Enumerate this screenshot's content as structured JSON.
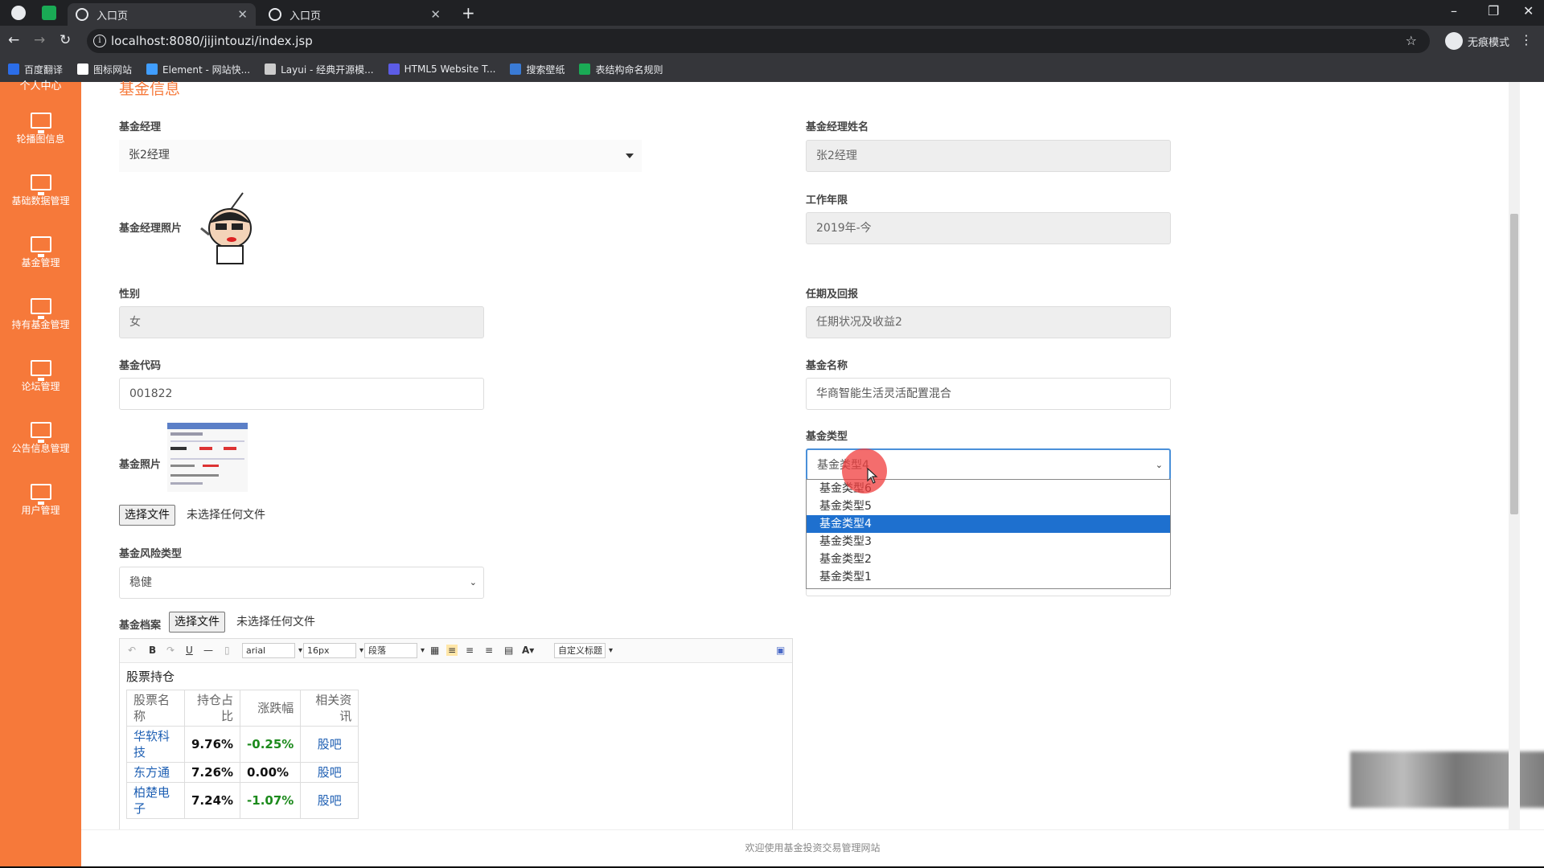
{
  "browser": {
    "tabs": [
      {
        "label": "入口页"
      },
      {
        "label": "入口页"
      }
    ],
    "url": "localhost:8080/jijintouzi/index.jsp",
    "incognito_label": "无痕模式",
    "bookmarks": [
      {
        "label": "百度翻译",
        "color": "#2b6de8"
      },
      {
        "label": "图标网站",
        "color": "#ffffff"
      },
      {
        "label": "Element - 网站快...",
        "color": "#409eff"
      },
      {
        "label": "Layui - 经典开源模...",
        "color": "#cccccc"
      },
      {
        "label": "HTML5 Website T...",
        "color": "#5c5ce6"
      },
      {
        "label": "搜索壁纸",
        "color": "#3a7bd5"
      },
      {
        "label": "表结构命名规则",
        "color": "#1aaa55"
      }
    ]
  },
  "sidebar": {
    "top_label": "个人中心",
    "items": [
      {
        "label": "轮播图信息"
      },
      {
        "label": "基础数据管理"
      },
      {
        "label": "基金管理"
      },
      {
        "label": "持有基金管理"
      },
      {
        "label": "论坛管理"
      },
      {
        "label": "公告信息管理"
      },
      {
        "label": "用户管理"
      }
    ]
  },
  "form": {
    "section_title": "基金信息",
    "manager_label": "基金经理",
    "manager_value": "张2经理",
    "manager_name_label": "基金经理姓名",
    "manager_name_value": "张2经理",
    "manager_photo_label": "基金经理照片",
    "work_years_label": "工作年限",
    "work_years_value": "2019年-今",
    "gender_label": "性别",
    "gender_value": "女",
    "tenure_label": "任期及回报",
    "tenure_value": "任期状况及收益2",
    "code_label": "基金代码",
    "code_value": "001822",
    "name_label": "基金名称",
    "name_value": "华商智能生活灵活配置混合",
    "photo_label": "基金照片",
    "type_label": "基金类型",
    "type_value": "基金类型4",
    "type_options": [
      "基金类型6",
      "基金类型5",
      "基金类型4",
      "基金类型3",
      "基金类型2",
      "基金类型1"
    ],
    "type_selected_index": 2,
    "file_button": "选择文件",
    "file_none": "未选择任何文件",
    "risk_label": "基金风险类型",
    "risk_value": "稳健",
    "archive_label": "基金档案"
  },
  "editor": {
    "font": "arial",
    "size": "16px",
    "paragraph": "段落",
    "custom_title": "自定义标题",
    "heading": "股票持仓",
    "columns": [
      "股票名称",
      "持仓占比",
      "涨跌幅",
      "相关资讯"
    ],
    "rows": [
      {
        "name": "华软科技",
        "ratio": "9.76%",
        "change": "-0.25%",
        "link": "股吧"
      },
      {
        "name": "东方通",
        "ratio": "7.26%",
        "change": "0.00%",
        "link": "股吧"
      },
      {
        "name": "柏楚电子",
        "ratio": "7.24%",
        "change": "-1.07%",
        "link": "股吧"
      }
    ]
  },
  "footer": "欢迎使用基金投资交易管理网站"
}
